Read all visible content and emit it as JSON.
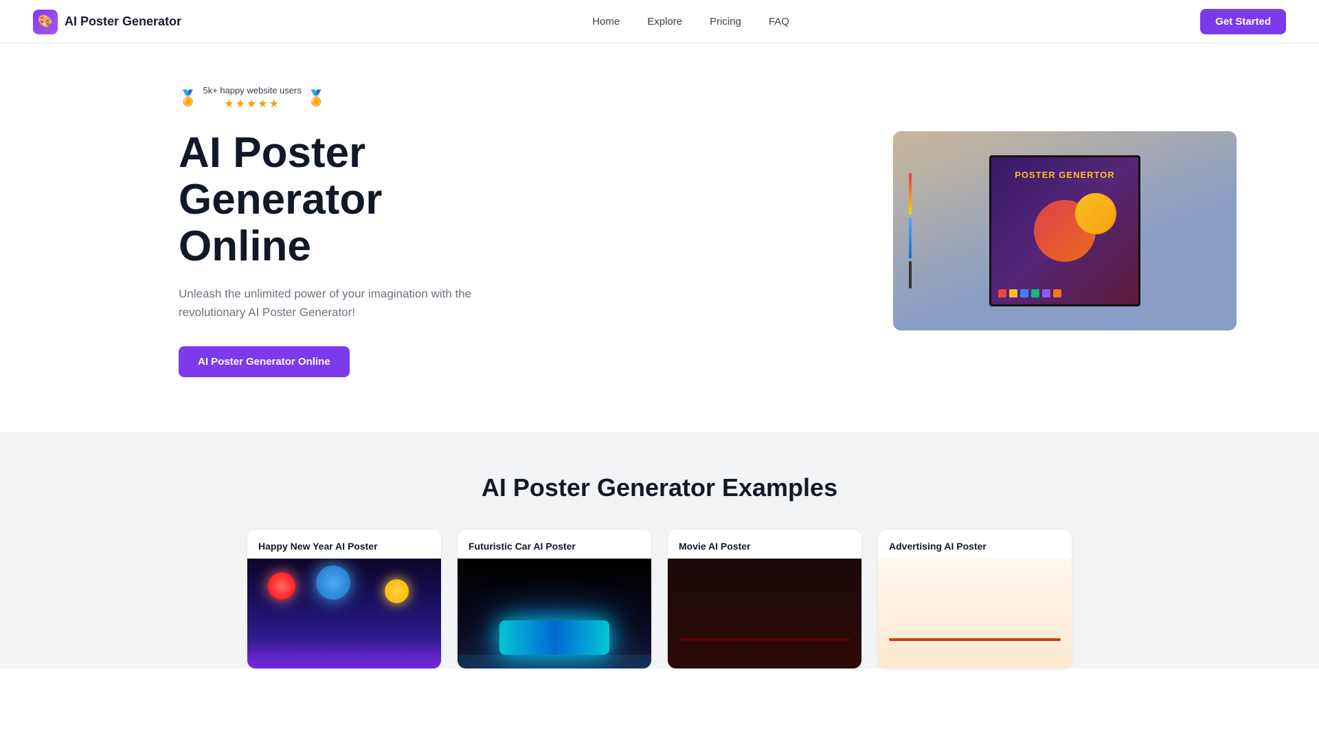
{
  "nav": {
    "logo_text": "AI Poster Generator",
    "logo_emoji": "🎨",
    "links": [
      {
        "label": "Home",
        "id": "home"
      },
      {
        "label": "Explore",
        "id": "explore"
      },
      {
        "label": "Pricing",
        "id": "pricing"
      },
      {
        "label": "FAQ",
        "id": "faq"
      }
    ],
    "cta_label": "Get Started"
  },
  "hero": {
    "badge_users": "5k+ happy website users",
    "badge_stars": "★★★★★",
    "title": "AI Poster Generator Online",
    "subtitle": "Unleash the unlimited power of your imagination with the revolutionary AI Poster Generator!",
    "cta_label": "AI Poster Generator Online",
    "poster_title": "POSTER GENERTOR"
  },
  "examples": {
    "section_title": "AI Poster Generator Examples",
    "cards": [
      {
        "title": "Happy New Year AI Poster",
        "type": "new-year"
      },
      {
        "title": "Futuristic Car AI Poster",
        "type": "car"
      },
      {
        "title": "Movie AI Poster",
        "type": "movie"
      },
      {
        "title": "Advertising AI Poster",
        "type": "advertising"
      }
    ]
  }
}
